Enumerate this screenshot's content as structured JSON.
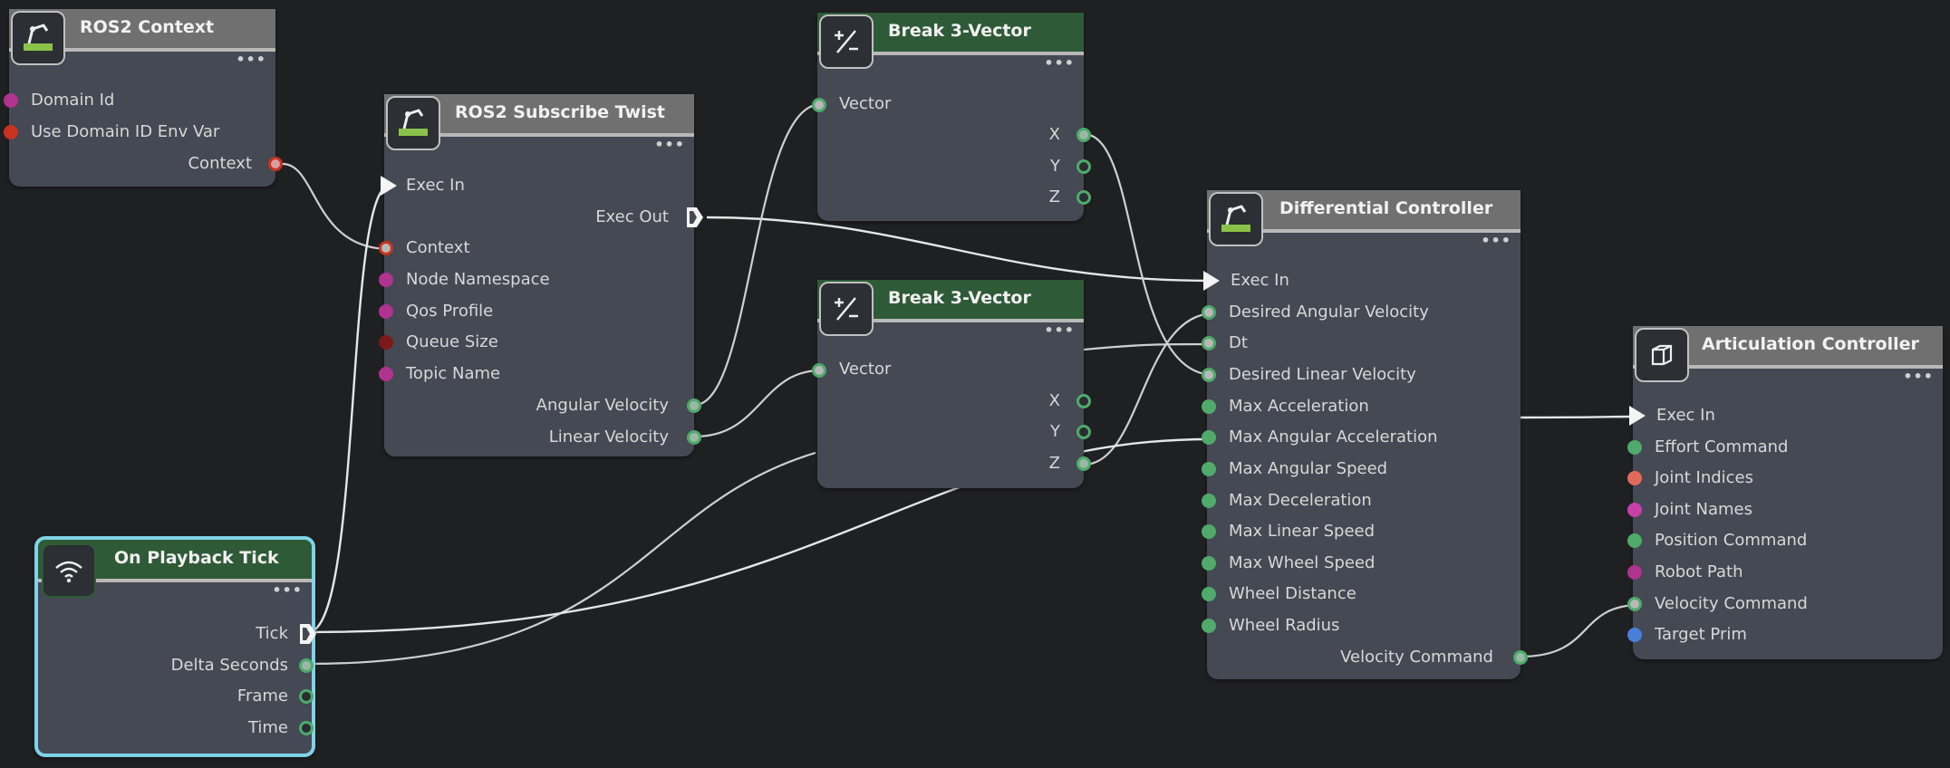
{
  "nodes": {
    "ros2_context": {
      "title": "ROS2 Context",
      "icon": "robot-arm-icon",
      "inputs": [
        "Domain Id",
        "Use Domain ID Env Var"
      ],
      "outputs": [
        "Context"
      ]
    },
    "subscribe_twist": {
      "title": "ROS2 Subscribe Twist",
      "icon": "robot-arm-icon",
      "exec_in": "Exec In",
      "exec_out": "Exec Out",
      "inputs": [
        "Context",
        "Node Namespace",
        "Qos Profile",
        "Queue Size",
        "Topic Name"
      ],
      "outputs": [
        "Angular Velocity",
        "Linear Velocity"
      ]
    },
    "break_vector_1": {
      "title": "Break 3-Vector",
      "icon": "plus-minus-icon",
      "inputs": [
        "Vector"
      ],
      "outputs": [
        "X",
        "Y",
        "Z"
      ]
    },
    "break_vector_2": {
      "title": "Break 3-Vector",
      "icon": "plus-minus-icon",
      "inputs": [
        "Vector"
      ],
      "outputs": [
        "X",
        "Y",
        "Z"
      ]
    },
    "on_playback_tick": {
      "title": "On Playback Tick",
      "icon": "wifi-broadcast-icon",
      "outputs": [
        "Tick",
        "Delta Seconds",
        "Frame",
        "Time"
      ]
    },
    "differential_controller": {
      "title": "Differential Controller",
      "icon": "robot-arm-icon",
      "exec_in": "Exec In",
      "inputs": [
        "Desired Angular Velocity",
        "Dt",
        "Desired Linear Velocity",
        "Max Acceleration",
        "Max Angular Acceleration",
        "Max Angular Speed",
        "Max Deceleration",
        "Max Linear Speed",
        "Max Wheel Speed",
        "Wheel Distance",
        "Wheel Radius"
      ],
      "outputs": [
        "Velocity Command"
      ]
    },
    "articulation_controller": {
      "title": "Articulation Controller",
      "icon": "cube-icon",
      "exec_in": "Exec In",
      "inputs": [
        "Effort Command",
        "Joint Indices",
        "Joint Names",
        "Position Command",
        "Robot Path",
        "Velocity Command",
        "Target Prim"
      ]
    }
  },
  "menu_glyph": "•••",
  "colors": {
    "background": "#1f2022",
    "node_body": "#444953",
    "header_gray": "#707070",
    "header_green": "#2f5a37",
    "pin_green": "#4faa6c",
    "pin_magenta": "#b0338f",
    "pin_red": "#c8331f",
    "pin_darkred": "#7a1a1a",
    "pin_salmon": "#e06a5a",
    "pin_blue": "#4a7fd9",
    "pin_gray": "#b8b8b8",
    "selected_outline": "#7fd3e6"
  }
}
